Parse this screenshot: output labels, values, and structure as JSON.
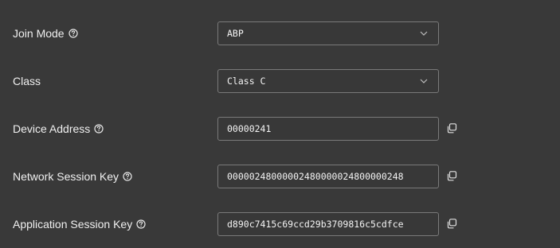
{
  "fields": [
    {
      "label": "Join Mode",
      "value": "ABP",
      "type": "select",
      "help": true
    },
    {
      "label": "Class",
      "value": "Class C",
      "type": "select",
      "help": false
    },
    {
      "label": "Device Address",
      "value": "00000241",
      "type": "text",
      "help": true,
      "copy": true
    },
    {
      "label": "Network Session Key",
      "value": "00000248000002480000024800000248",
      "type": "text",
      "help": true,
      "copy": true
    },
    {
      "label": "Application Session Key",
      "value": "d890c7415c69ccd29b3709816c5cdfce",
      "type": "text",
      "help": true,
      "copy": true
    }
  ],
  "icons": {
    "help": "question-circle-icon",
    "chevron": "chevron-down-icon",
    "copy": "copy-icon"
  },
  "colors": {
    "background": "#393939",
    "field_border": "#7a7a7a",
    "text": "#f0f0f0"
  }
}
